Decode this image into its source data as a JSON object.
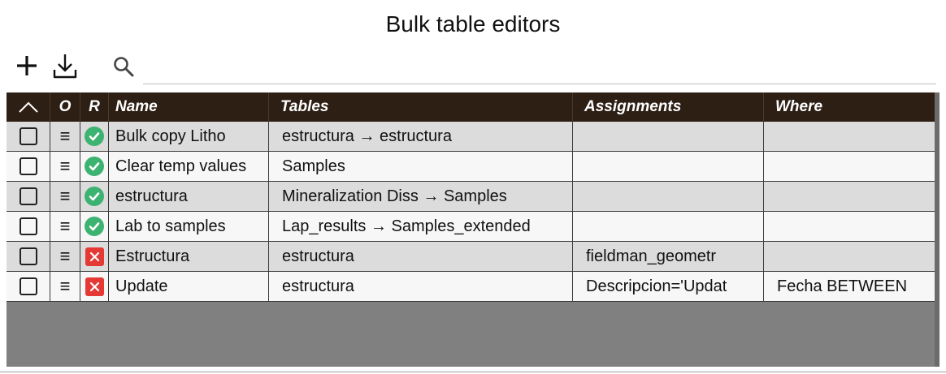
{
  "title": "Bulk table editors",
  "toolbar": {
    "add_icon": "plus-icon",
    "import_icon": "download-icon",
    "search_icon": "search-icon",
    "search_value": ""
  },
  "columns": [
    "O",
    "R",
    "Name",
    "Tables",
    "Assignments",
    "Where"
  ],
  "rows": [
    {
      "status": "ok",
      "name": "Bulk copy Litho",
      "tables": "estructura → estructura",
      "assignments": "",
      "where": ""
    },
    {
      "status": "ok",
      "name": "Clear temp values",
      "tables": "Samples",
      "assignments": "",
      "where": ""
    },
    {
      "status": "ok",
      "name": "estructura",
      "tables": "Mineralization Diss → Samples",
      "assignments": "",
      "where": ""
    },
    {
      "status": "ok",
      "name": "Lab to samples",
      "tables": "Lap_results → Samples_extended",
      "assignments": "",
      "where": ""
    },
    {
      "status": "error",
      "name": "Estructura",
      "tables": "estructura",
      "assignments": "fieldman_geometr",
      "where": ""
    },
    {
      "status": "error",
      "name": "Update",
      "tables": "estructura",
      "assignments": "Descripcion='Updat",
      "where": "Fecha BETWEEN"
    }
  ],
  "colors": {
    "header_bg": "#2e1f15",
    "ok": "#3cb371",
    "error": "#e53935",
    "empty_area": "#808080"
  }
}
